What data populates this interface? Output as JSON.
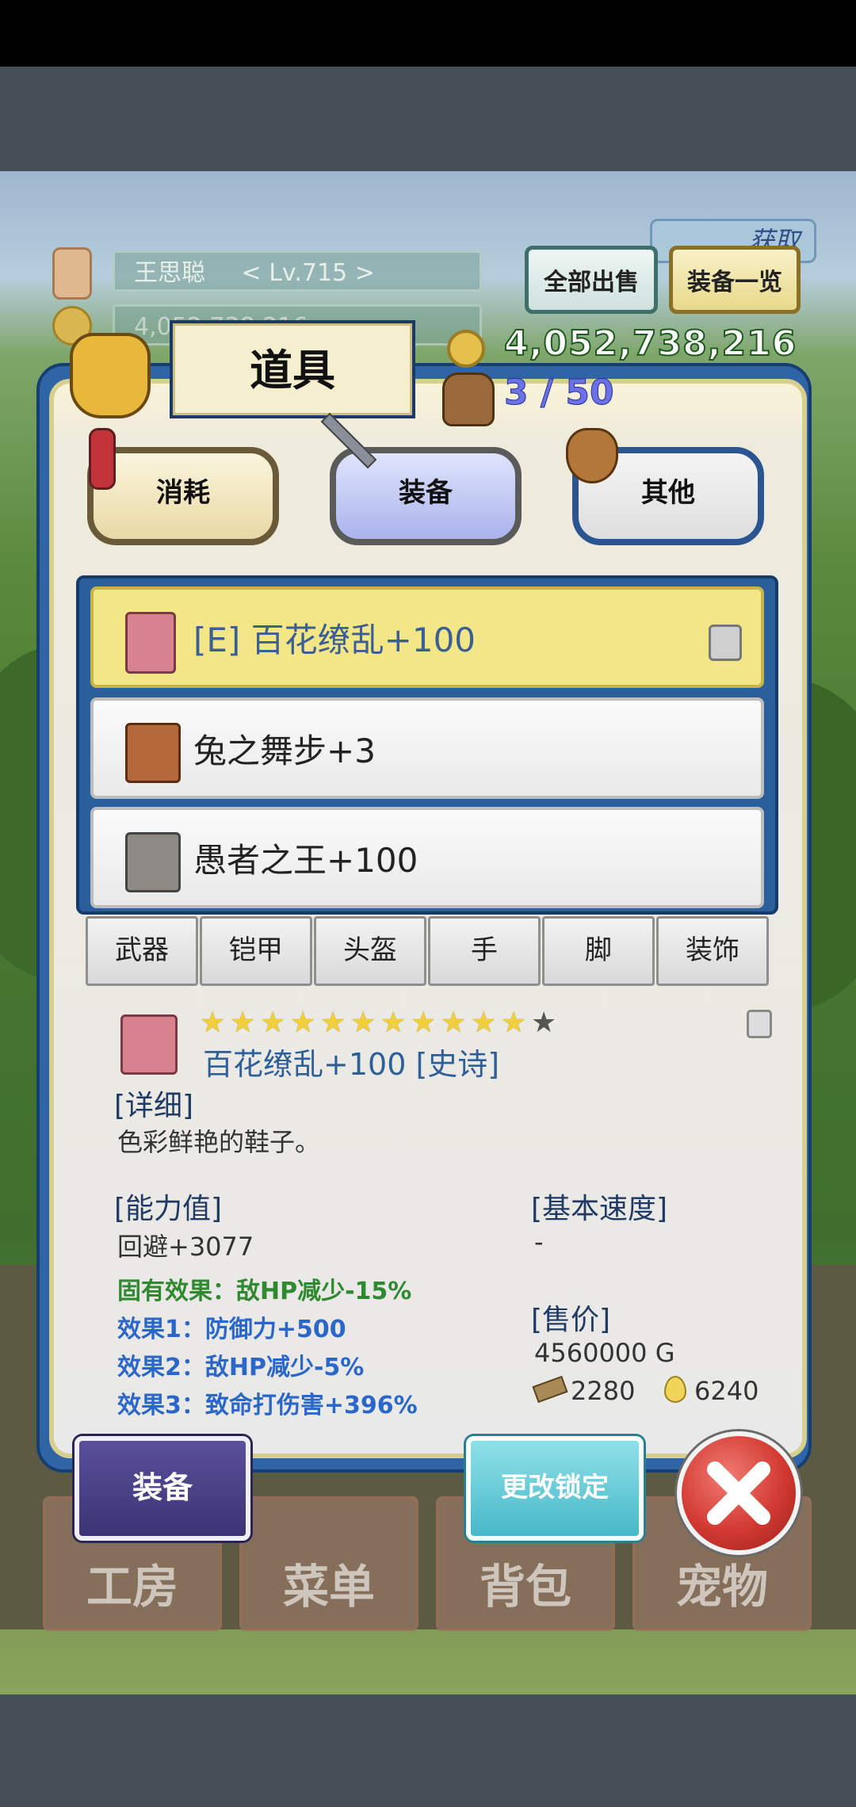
{
  "hud": {
    "player_name": "王思聪",
    "player_level": "< Lv.715 >",
    "player_gold_partial": "4,052,738,216",
    "gold": "4,052,738,216",
    "bag_capacity": "3 / 50",
    "sell_all_label": "全部出售",
    "equip_list_label": "装备一览",
    "top_badge": "获取"
  },
  "panel": {
    "title": "道具",
    "tabs": [
      {
        "label": "消耗",
        "active": false
      },
      {
        "label": "装备",
        "active": true
      },
      {
        "label": "其他",
        "active": false
      }
    ],
    "items": [
      {
        "name": "[E] 百花缭乱+100",
        "selected": true,
        "locked": true
      },
      {
        "name": "兔之舞步+3",
        "selected": false,
        "locked": false
      },
      {
        "name": "愚者之王+100",
        "selected": false,
        "locked": false
      }
    ],
    "categories": [
      "武器",
      "铠甲",
      "头盔",
      "手",
      "脚",
      "装饰"
    ]
  },
  "detail": {
    "stars_filled": 11,
    "stars_total": 12,
    "item_name": "百花缭乱+100 [史诗]",
    "detail_heading": "[详细]",
    "description": "色彩鲜艳的鞋子。",
    "ability_heading": "[能力值]",
    "ability_value": "回避+3077",
    "intrinsic_effect": "固有效果：敌HP减少-15%",
    "effect1": "效果1：防御力+500",
    "effect2": "效果2：敌HP减少-5%",
    "effect3": "效果3：致命打伤害+396%",
    "speed_heading": "[基本速度]",
    "speed_value": "-",
    "price_heading": "[售价]",
    "price_value": "4560000 G",
    "material1": "2280",
    "material2": "6240"
  },
  "actions": {
    "equip_label": "装备",
    "lock_label": "更改锁定"
  },
  "bottom_nav": [
    "工房",
    "菜单",
    "背包",
    "宠物"
  ],
  "colors": {
    "panel_blue": "#2f64a6",
    "selected_item": "#f3e686",
    "active_tab": "#b9c2f0",
    "intrinsic_effect": "#2f8a2f",
    "effect_blue": "#2a67c8",
    "close_red": "#d23a32"
  }
}
